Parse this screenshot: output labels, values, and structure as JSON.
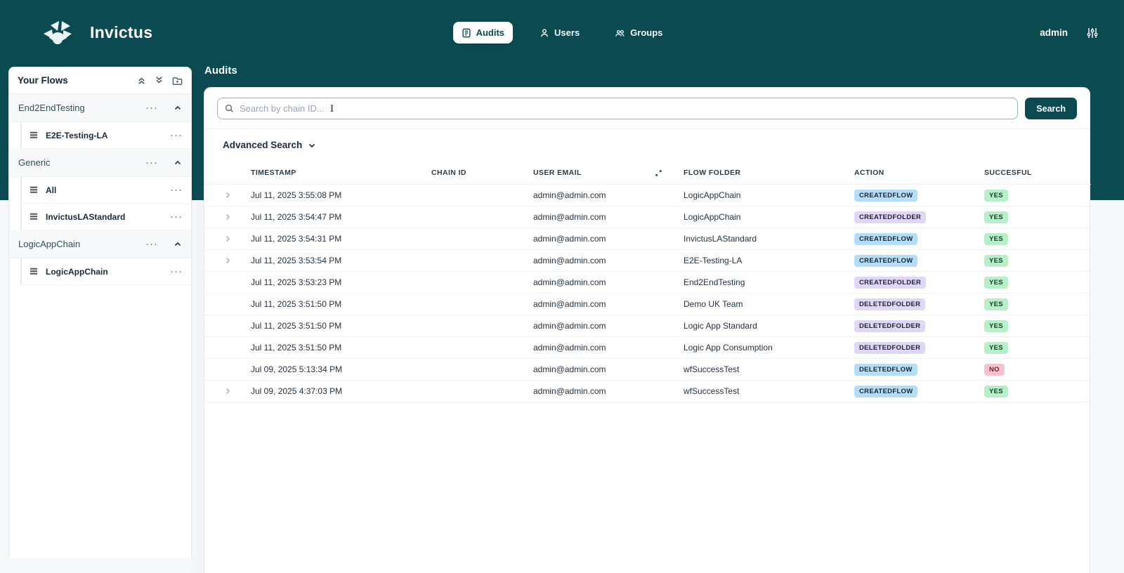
{
  "colors": {
    "teal": "#0b4a50",
    "badge_flow_bg": "#b4def7",
    "badge_folder_bg": "#e2d6f8",
    "badge_yes_bg": "#b6efc8",
    "badge_no_bg": "#f6c3cb"
  },
  "header": {
    "brand": "Invictus",
    "nav": [
      {
        "id": "audits",
        "label": "Audits",
        "icon": "audit-log-icon",
        "active": true
      },
      {
        "id": "users",
        "label": "Users",
        "icon": "user-icon",
        "active": false
      },
      {
        "id": "groups",
        "label": "Groups",
        "icon": "groups-icon",
        "active": false
      }
    ],
    "user": "admin",
    "settings_icon": "sliders-icon"
  },
  "sidebar": {
    "title": "Your Flows",
    "tools": [
      "collapse-all-icon",
      "expand-all-icon",
      "add-folder-icon"
    ],
    "sections": [
      {
        "label": "End2EndTesting",
        "items": [
          "E2E-Testing-LA"
        ]
      },
      {
        "label": "Generic",
        "items": [
          "All",
          "InvictusLAStandard"
        ]
      },
      {
        "label": "LogicAppChain",
        "items": [
          "LogicAppChain"
        ]
      }
    ]
  },
  "main": {
    "title": "Audits",
    "search": {
      "placeholder": "Search by chain ID...",
      "button": "Search"
    },
    "advanced_label": "Advanced Search",
    "table": {
      "headers": {
        "timestamp": "TIMESTAMP",
        "chain_id": "CHAIN ID",
        "user_email": "USER EMAIL",
        "flow_folder": "FLOW FOLDER",
        "action": "ACTION",
        "succesful": "SUCCESFUL"
      },
      "rows": [
        {
          "expandable": true,
          "timestamp": "Jul 11, 2025 3:55:08 PM",
          "chain_id": "",
          "user_email": "admin@admin.com",
          "flow_folder": "LogicAppChain",
          "action": "CREATEDFLOW",
          "succesful": "YES"
        },
        {
          "expandable": true,
          "timestamp": "Jul 11, 2025 3:54:47 PM",
          "chain_id": "",
          "user_email": "admin@admin.com",
          "flow_folder": "LogicAppChain",
          "action": "CREATEDFOLDER",
          "succesful": "YES"
        },
        {
          "expandable": true,
          "timestamp": "Jul 11, 2025 3:54:31 PM",
          "chain_id": "",
          "user_email": "admin@admin.com",
          "flow_folder": "InvictusLAStandard",
          "action": "CREATEDFLOW",
          "succesful": "YES"
        },
        {
          "expandable": true,
          "timestamp": "Jul 11, 2025 3:53:54 PM",
          "chain_id": "",
          "user_email": "admin@admin.com",
          "flow_folder": "E2E-Testing-LA",
          "action": "CREATEDFLOW",
          "succesful": "YES"
        },
        {
          "expandable": false,
          "timestamp": "Jul 11, 2025 3:53:23 PM",
          "chain_id": "",
          "user_email": "admin@admin.com",
          "flow_folder": "End2EndTesting",
          "action": "CREATEDFOLDER",
          "succesful": "YES"
        },
        {
          "expandable": false,
          "timestamp": "Jul 11, 2025 3:51:50 PM",
          "chain_id": "",
          "user_email": "admin@admin.com",
          "flow_folder": "Demo UK Team",
          "action": "DELETEDFOLDER",
          "succesful": "YES"
        },
        {
          "expandable": false,
          "timestamp": "Jul 11, 2025 3:51:50 PM",
          "chain_id": "",
          "user_email": "admin@admin.com",
          "flow_folder": "Logic App Standard",
          "action": "DELETEDFOLDER",
          "succesful": "YES"
        },
        {
          "expandable": false,
          "timestamp": "Jul 11, 2025 3:51:50 PM",
          "chain_id": "",
          "user_email": "admin@admin.com",
          "flow_folder": "Logic App Consumption",
          "action": "DELETEDFOLDER",
          "succesful": "YES"
        },
        {
          "expandable": false,
          "timestamp": "Jul 09, 2025 5:13:34 PM",
          "chain_id": "",
          "user_email": "admin@admin.com",
          "flow_folder": "wfSuccessTest",
          "action": "DELETEDFLOW",
          "succesful": "NO"
        },
        {
          "expandable": true,
          "timestamp": "Jul 09, 2025 4:37:03 PM",
          "chain_id": "",
          "user_email": "admin@admin.com",
          "flow_folder": "wfSuccessTest",
          "action": "CREATEDFLOW",
          "succesful": "YES"
        }
      ]
    }
  }
}
